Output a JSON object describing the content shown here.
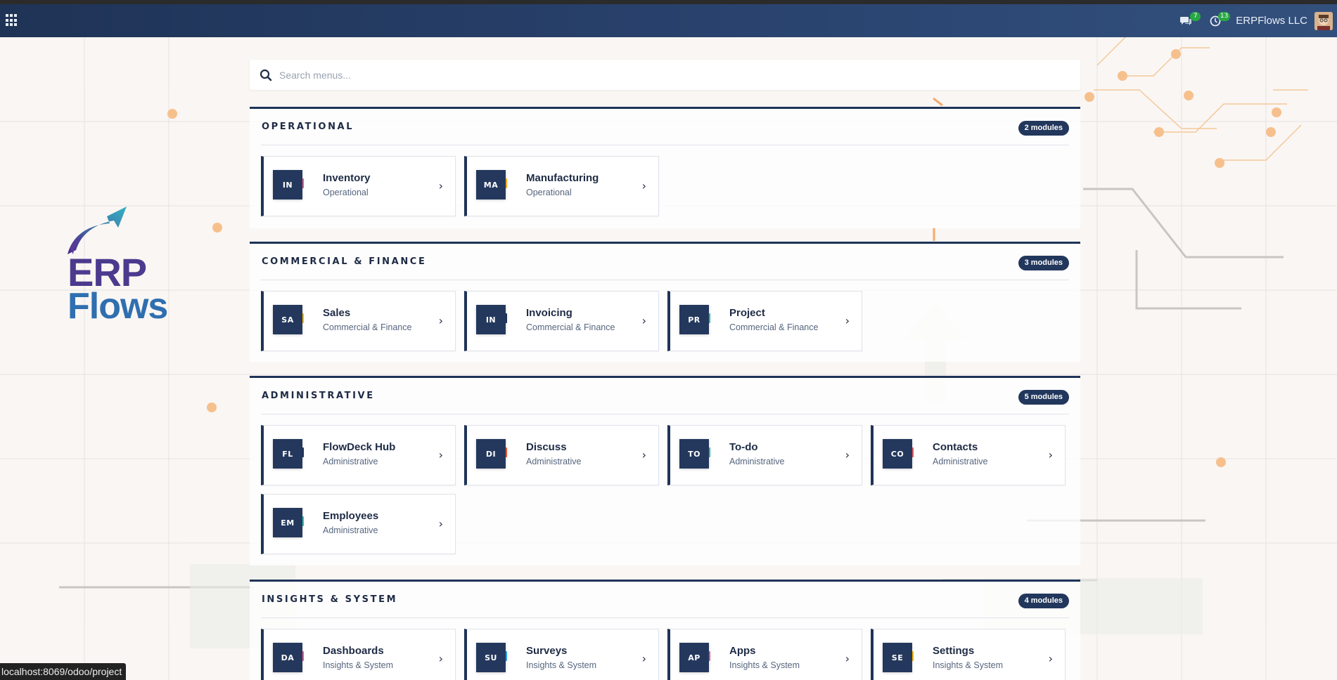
{
  "navbar": {
    "apps_icon": "grid-icon",
    "messages_count": "7",
    "activities_count": "13",
    "company": "ERPFlows LLC"
  },
  "logo": {
    "line1": "ERP",
    "line2": "Flows"
  },
  "search": {
    "placeholder": "Search menus..."
  },
  "colors": {
    "navy": "#1e3357",
    "badge_green": "#28a745"
  },
  "sections": [
    {
      "title": "OPERATIONAL",
      "badge": "2 modules",
      "cards": [
        {
          "abbr": "IN",
          "title": "Inventory",
          "sub": "Operational"
        },
        {
          "abbr": "MA",
          "title": "Manufacturing",
          "sub": "Operational"
        }
      ]
    },
    {
      "title": "COMMERCIAL & FINANCE",
      "badge": "3 modules",
      "cards": [
        {
          "abbr": "SA",
          "title": "Sales",
          "sub": "Commercial & Finance"
        },
        {
          "abbr": "IN",
          "title": "Invoicing",
          "sub": "Commercial & Finance"
        },
        {
          "abbr": "PR",
          "title": "Project",
          "sub": "Commercial & Finance"
        }
      ]
    },
    {
      "title": "ADMINISTRATIVE",
      "badge": "5 modules",
      "cards": [
        {
          "abbr": "FL",
          "title": "FlowDeck Hub",
          "sub": "Administrative"
        },
        {
          "abbr": "DI",
          "title": "Discuss",
          "sub": "Administrative"
        },
        {
          "abbr": "TO",
          "title": "To-do",
          "sub": "Administrative"
        },
        {
          "abbr": "CO",
          "title": "Contacts",
          "sub": "Administrative"
        },
        {
          "abbr": "EM",
          "title": "Employees",
          "sub": "Administrative"
        }
      ]
    },
    {
      "title": "INSIGHTS & SYSTEM",
      "badge": "4 modules",
      "cards": [
        {
          "abbr": "DA",
          "title": "Dashboards",
          "sub": "Insights & System"
        },
        {
          "abbr": "SU",
          "title": "Surveys",
          "sub": "Insights & System"
        },
        {
          "abbr": "AP",
          "title": "Apps",
          "sub": "Insights & System"
        },
        {
          "abbr": "SE",
          "title": "Settings",
          "sub": "Insights & System"
        }
      ]
    }
  ],
  "chevron": "›",
  "statusbar": {
    "url": "localhost:8069/odoo/project"
  }
}
